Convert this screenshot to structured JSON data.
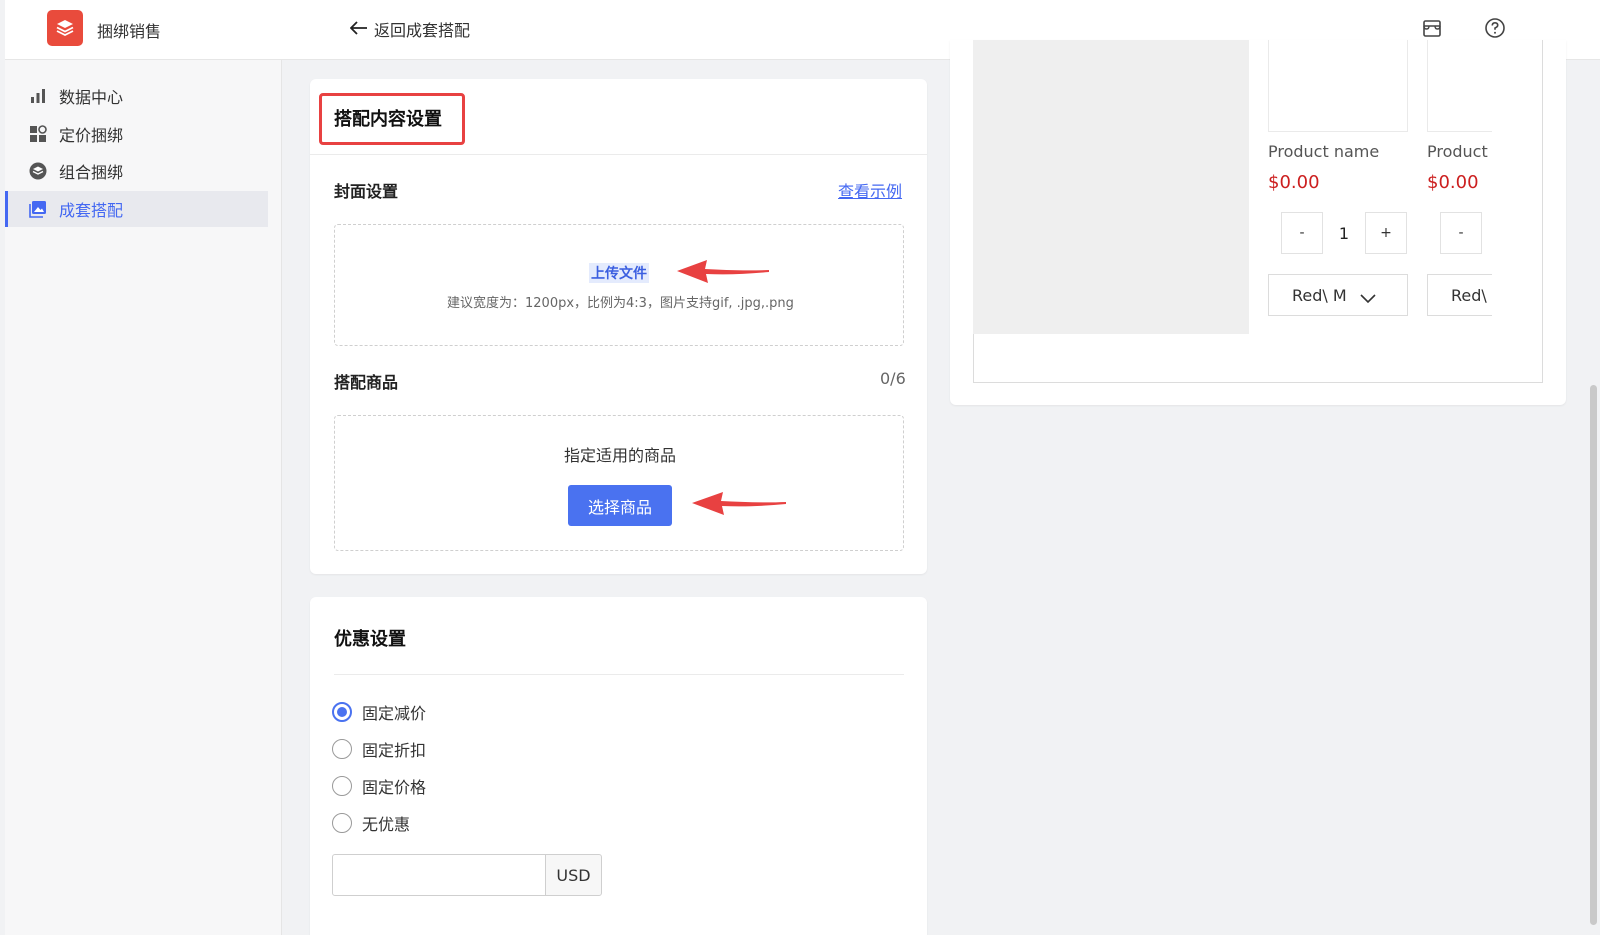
{
  "header": {
    "app_name": "捆绑销售",
    "back_label": "返回成套搭配",
    "icons": [
      "store-icon",
      "help-icon"
    ]
  },
  "sidebar": {
    "items": [
      {
        "label": "数据中心",
        "icon": "bar-chart-icon",
        "active": false
      },
      {
        "label": "定价捆绑",
        "icon": "grid-icon",
        "active": false
      },
      {
        "label": "组合捆绑",
        "icon": "layers-icon",
        "active": false
      },
      {
        "label": "成套搭配",
        "icon": "image-icon",
        "active": true
      }
    ]
  },
  "content_settings": {
    "title": "搭配内容设置",
    "cover": {
      "label": "封面设置",
      "example_link": "查看示例",
      "upload_label": "上传文件",
      "hint": "建议宽度为：1200px，比例为4:3，图片支持gif, .jpg,.png"
    },
    "products": {
      "label": "搭配商品",
      "count": "0/6",
      "prompt": "指定适用的商品",
      "select_button": "选择商品"
    }
  },
  "discount_settings": {
    "title": "优惠设置",
    "options": [
      {
        "label": "固定减价",
        "checked": true
      },
      {
        "label": "固定折扣",
        "checked": false
      },
      {
        "label": "固定价格",
        "checked": false
      },
      {
        "label": "无优惠",
        "checked": false
      }
    ],
    "amount_value": "",
    "currency": "USD"
  },
  "preview": {
    "products": [
      {
        "name": "Product name",
        "price": "$0.00",
        "qty_minus": "-",
        "qty": "1",
        "qty_plus": "+",
        "variant": "Red\\ M"
      },
      {
        "name": "Product",
        "price": "$0.00",
        "qty_minus": "-",
        "variant": "Red\\"
      }
    ]
  },
  "colors": {
    "accent": "#4468f2",
    "brand": "#e94b3c",
    "price": "#cc1f1f",
    "highlight_box": "#e84141",
    "annotation_arrow": "#e84141"
  }
}
